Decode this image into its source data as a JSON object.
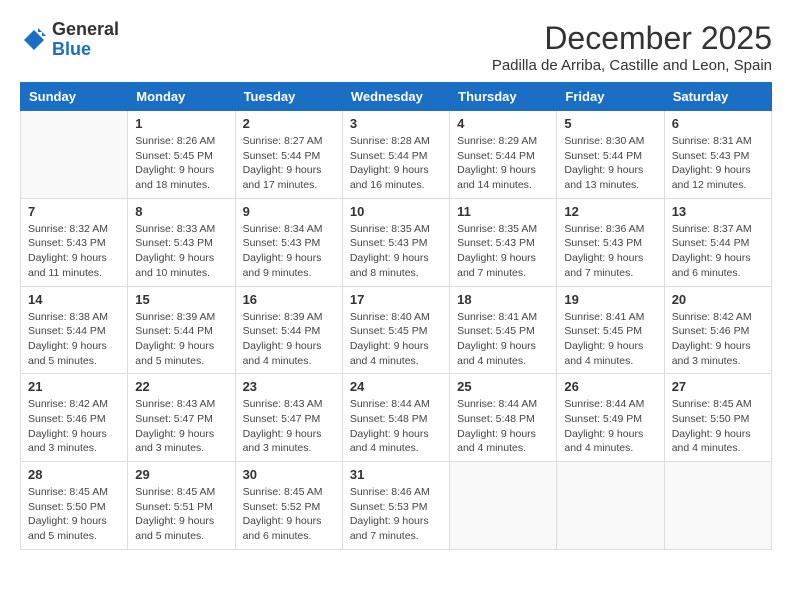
{
  "header": {
    "logo_general": "General",
    "logo_blue": "Blue",
    "month_title": "December 2025",
    "subtitle": "Padilla de Arriba, Castille and Leon, Spain"
  },
  "weekdays": [
    "Sunday",
    "Monday",
    "Tuesday",
    "Wednesday",
    "Thursday",
    "Friday",
    "Saturday"
  ],
  "weeks": [
    [
      {
        "day": "",
        "sunrise": "",
        "sunset": "",
        "daylight": ""
      },
      {
        "day": "1",
        "sunrise": "Sunrise: 8:26 AM",
        "sunset": "Sunset: 5:45 PM",
        "daylight": "Daylight: 9 hours and 18 minutes."
      },
      {
        "day": "2",
        "sunrise": "Sunrise: 8:27 AM",
        "sunset": "Sunset: 5:44 PM",
        "daylight": "Daylight: 9 hours and 17 minutes."
      },
      {
        "day": "3",
        "sunrise": "Sunrise: 8:28 AM",
        "sunset": "Sunset: 5:44 PM",
        "daylight": "Daylight: 9 hours and 16 minutes."
      },
      {
        "day": "4",
        "sunrise": "Sunrise: 8:29 AM",
        "sunset": "Sunset: 5:44 PM",
        "daylight": "Daylight: 9 hours and 14 minutes."
      },
      {
        "day": "5",
        "sunrise": "Sunrise: 8:30 AM",
        "sunset": "Sunset: 5:44 PM",
        "daylight": "Daylight: 9 hours and 13 minutes."
      },
      {
        "day": "6",
        "sunrise": "Sunrise: 8:31 AM",
        "sunset": "Sunset: 5:43 PM",
        "daylight": "Daylight: 9 hours and 12 minutes."
      }
    ],
    [
      {
        "day": "7",
        "sunrise": "Sunrise: 8:32 AM",
        "sunset": "Sunset: 5:43 PM",
        "daylight": "Daylight: 9 hours and 11 minutes."
      },
      {
        "day": "8",
        "sunrise": "Sunrise: 8:33 AM",
        "sunset": "Sunset: 5:43 PM",
        "daylight": "Daylight: 9 hours and 10 minutes."
      },
      {
        "day": "9",
        "sunrise": "Sunrise: 8:34 AM",
        "sunset": "Sunset: 5:43 PM",
        "daylight": "Daylight: 9 hours and 9 minutes."
      },
      {
        "day": "10",
        "sunrise": "Sunrise: 8:35 AM",
        "sunset": "Sunset: 5:43 PM",
        "daylight": "Daylight: 9 hours and 8 minutes."
      },
      {
        "day": "11",
        "sunrise": "Sunrise: 8:35 AM",
        "sunset": "Sunset: 5:43 PM",
        "daylight": "Daylight: 9 hours and 7 minutes."
      },
      {
        "day": "12",
        "sunrise": "Sunrise: 8:36 AM",
        "sunset": "Sunset: 5:43 PM",
        "daylight": "Daylight: 9 hours and 7 minutes."
      },
      {
        "day": "13",
        "sunrise": "Sunrise: 8:37 AM",
        "sunset": "Sunset: 5:44 PM",
        "daylight": "Daylight: 9 hours and 6 minutes."
      }
    ],
    [
      {
        "day": "14",
        "sunrise": "Sunrise: 8:38 AM",
        "sunset": "Sunset: 5:44 PM",
        "daylight": "Daylight: 9 hours and 5 minutes."
      },
      {
        "day": "15",
        "sunrise": "Sunrise: 8:39 AM",
        "sunset": "Sunset: 5:44 PM",
        "daylight": "Daylight: 9 hours and 5 minutes."
      },
      {
        "day": "16",
        "sunrise": "Sunrise: 8:39 AM",
        "sunset": "Sunset: 5:44 PM",
        "daylight": "Daylight: 9 hours and 4 minutes."
      },
      {
        "day": "17",
        "sunrise": "Sunrise: 8:40 AM",
        "sunset": "Sunset: 5:45 PM",
        "daylight": "Daylight: 9 hours and 4 minutes."
      },
      {
        "day": "18",
        "sunrise": "Sunrise: 8:41 AM",
        "sunset": "Sunset: 5:45 PM",
        "daylight": "Daylight: 9 hours and 4 minutes."
      },
      {
        "day": "19",
        "sunrise": "Sunrise: 8:41 AM",
        "sunset": "Sunset: 5:45 PM",
        "daylight": "Daylight: 9 hours and 4 minutes."
      },
      {
        "day": "20",
        "sunrise": "Sunrise: 8:42 AM",
        "sunset": "Sunset: 5:46 PM",
        "daylight": "Daylight: 9 hours and 3 minutes."
      }
    ],
    [
      {
        "day": "21",
        "sunrise": "Sunrise: 8:42 AM",
        "sunset": "Sunset: 5:46 PM",
        "daylight": "Daylight: 9 hours and 3 minutes."
      },
      {
        "day": "22",
        "sunrise": "Sunrise: 8:43 AM",
        "sunset": "Sunset: 5:47 PM",
        "daylight": "Daylight: 9 hours and 3 minutes."
      },
      {
        "day": "23",
        "sunrise": "Sunrise: 8:43 AM",
        "sunset": "Sunset: 5:47 PM",
        "daylight": "Daylight: 9 hours and 3 minutes."
      },
      {
        "day": "24",
        "sunrise": "Sunrise: 8:44 AM",
        "sunset": "Sunset: 5:48 PM",
        "daylight": "Daylight: 9 hours and 4 minutes."
      },
      {
        "day": "25",
        "sunrise": "Sunrise: 8:44 AM",
        "sunset": "Sunset: 5:48 PM",
        "daylight": "Daylight: 9 hours and 4 minutes."
      },
      {
        "day": "26",
        "sunrise": "Sunrise: 8:44 AM",
        "sunset": "Sunset: 5:49 PM",
        "daylight": "Daylight: 9 hours and 4 minutes."
      },
      {
        "day": "27",
        "sunrise": "Sunrise: 8:45 AM",
        "sunset": "Sunset: 5:50 PM",
        "daylight": "Daylight: 9 hours and 4 minutes."
      }
    ],
    [
      {
        "day": "28",
        "sunrise": "Sunrise: 8:45 AM",
        "sunset": "Sunset: 5:50 PM",
        "daylight": "Daylight: 9 hours and 5 minutes."
      },
      {
        "day": "29",
        "sunrise": "Sunrise: 8:45 AM",
        "sunset": "Sunset: 5:51 PM",
        "daylight": "Daylight: 9 hours and 5 minutes."
      },
      {
        "day": "30",
        "sunrise": "Sunrise: 8:45 AM",
        "sunset": "Sunset: 5:52 PM",
        "daylight": "Daylight: 9 hours and 6 minutes."
      },
      {
        "day": "31",
        "sunrise": "Sunrise: 8:46 AM",
        "sunset": "Sunset: 5:53 PM",
        "daylight": "Daylight: 9 hours and 7 minutes."
      },
      {
        "day": "",
        "sunrise": "",
        "sunset": "",
        "daylight": ""
      },
      {
        "day": "",
        "sunrise": "",
        "sunset": "",
        "daylight": ""
      },
      {
        "day": "",
        "sunrise": "",
        "sunset": "",
        "daylight": ""
      }
    ]
  ]
}
